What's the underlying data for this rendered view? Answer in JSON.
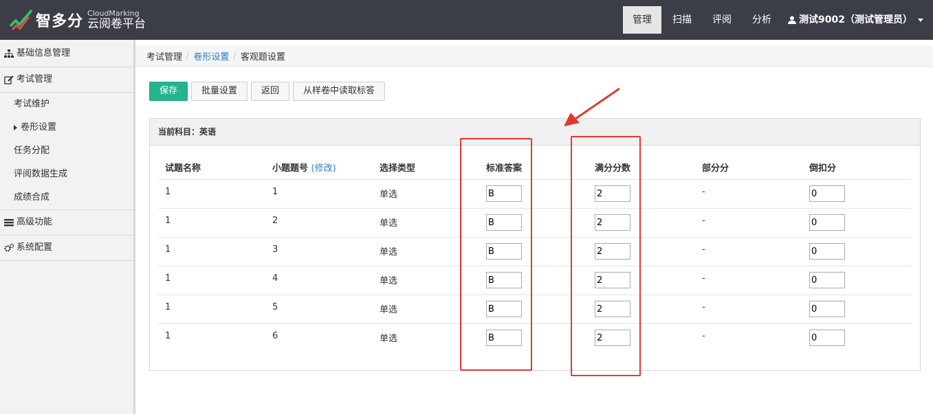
{
  "brand": {
    "name": "智多分",
    "sub_en": "CloudMarking",
    "sub_zh": "云阅卷平台"
  },
  "nav": {
    "items": [
      {
        "label": "管理",
        "active": true
      },
      {
        "label": "扫描",
        "active": false
      },
      {
        "label": "评阅",
        "active": false
      },
      {
        "label": "分析",
        "active": false
      }
    ],
    "user": "测试9002（测试管理员）"
  },
  "sidebar": {
    "basic": "基础信息管理",
    "exam": "考试管理",
    "exam_items": [
      "考试维护",
      "卷形设置",
      "任务分配",
      "评阅数据生成",
      "成绩合成"
    ],
    "advanced": "高级功能",
    "system": "系统配置"
  },
  "breadcrumb": [
    "考试管理",
    "卷形设置",
    "客观题设置"
  ],
  "toolbar": {
    "save": "保存",
    "batch": "批量设置",
    "back": "返回",
    "read": "从样卷中读取标答"
  },
  "panel": {
    "subject": "当前科目：英语"
  },
  "table": {
    "headers": {
      "name": "试题名称",
      "number": "小题题号",
      "edit": "(修改)",
      "type": "选择类型",
      "answer": "标准答案",
      "score": "满分分数",
      "partial": "部分分",
      "deduct": "倒扣分"
    },
    "rows": [
      {
        "name": "1",
        "number": "1",
        "type": "单选",
        "answer": "B",
        "score": "2",
        "partial": "-",
        "deduct": "0"
      },
      {
        "name": "1",
        "number": "2",
        "type": "单选",
        "answer": "B",
        "score": "2",
        "partial": "-",
        "deduct": "0"
      },
      {
        "name": "1",
        "number": "3",
        "type": "单选",
        "answer": "B",
        "score": "2",
        "partial": "-",
        "deduct": "0"
      },
      {
        "name": "1",
        "number": "4",
        "type": "单选",
        "answer": "B",
        "score": "2",
        "partial": "-",
        "deduct": "0"
      },
      {
        "name": "1",
        "number": "5",
        "type": "单选",
        "answer": "B",
        "score": "2",
        "partial": "-",
        "deduct": "0"
      },
      {
        "name": "1",
        "number": "6",
        "type": "单选",
        "answer": "B",
        "score": "2",
        "partial": "-",
        "deduct": "0"
      }
    ]
  },
  "colors": {
    "accent": "#25b48e",
    "topbar": "#3b3d47",
    "link": "#2a7fc1",
    "annotation": "#e03a2e"
  }
}
